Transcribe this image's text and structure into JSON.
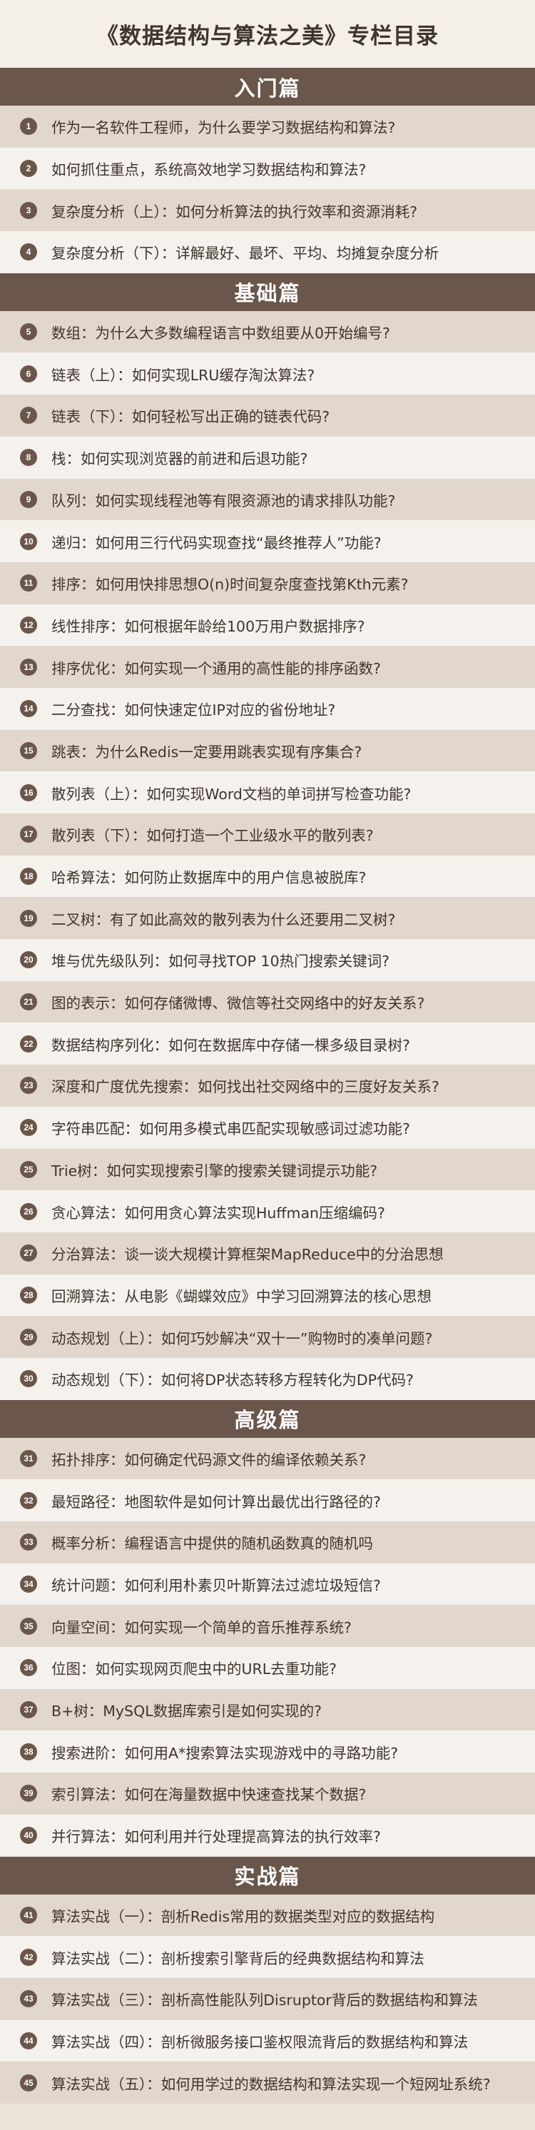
{
  "title": "《数据结构与算法之美》专栏目录",
  "sections": [
    {
      "name": "入门篇",
      "items": [
        {
          "num": "1",
          "text": "作为一名软件工程师，为什么要学习数据结构和算法?"
        },
        {
          "num": "2",
          "text": "如何抓住重点，系统高效地学习数据结构和算法?"
        },
        {
          "num": "3",
          "text": "复杂度分析（上）：如何分析算法的执行效率和资源消耗?"
        },
        {
          "num": "4",
          "text": "复杂度分析（下）：详解最好、最坏、平均、均摊复杂度分析"
        }
      ]
    },
    {
      "name": "基础篇",
      "items": [
        {
          "num": "5",
          "text": "数组：为什么大多数编程语言中数组要从0开始编号?"
        },
        {
          "num": "6",
          "text": "链表（上）：如何实现LRU缓存淘汰算法?"
        },
        {
          "num": "7",
          "text": "链表（下）：如何轻松写出正确的链表代码?"
        },
        {
          "num": "8",
          "text": "栈：如何实现浏览器的前进和后退功能?"
        },
        {
          "num": "9",
          "text": "队列：如何实现线程池等有限资源池的请求排队功能?"
        },
        {
          "num": "10",
          "text": "递归：如何用三行代码实现查找“最终推荐人”功能?"
        },
        {
          "num": "11",
          "text": "排序：如何用快排思想O(n)时间复杂度查找第Kth元素?"
        },
        {
          "num": "12",
          "text": "线性排序：如何根据年龄给100万用户数据排序?"
        },
        {
          "num": "13",
          "text": "排序优化：如何实现一个通用的高性能的排序函数?"
        },
        {
          "num": "14",
          "text": "二分查找：如何快速定位IP对应的省份地址?"
        },
        {
          "num": "15",
          "text": "跳表：为什么Redis一定要用跳表实现有序集合?"
        },
        {
          "num": "16",
          "text": "散列表（上）：如何实现Word文档的单词拼写检查功能?"
        },
        {
          "num": "17",
          "text": "散列表（下）：如何打造一个工业级水平的散列表?"
        },
        {
          "num": "18",
          "text": "哈希算法：如何防止数据库中的用户信息被脱库?"
        },
        {
          "num": "19",
          "text": "二叉树：有了如此高效的散列表为什么还要用二叉树?"
        },
        {
          "num": "20",
          "text": "堆与优先级队列：如何寻找TOP 10热门搜索关键词?"
        },
        {
          "num": "21",
          "text": "图的表示：如何存储微博、微信等社交网络中的好友关系?"
        },
        {
          "num": "22",
          "text": "数据结构序列化：如何在数据库中存储一棵多级目录树?"
        },
        {
          "num": "23",
          "text": "深度和广度优先搜索：如何找出社交网络中的三度好友关系?"
        },
        {
          "num": "24",
          "text": "字符串匹配：如何用多模式串匹配实现敏感词过滤功能?"
        },
        {
          "num": "25",
          "text": "Trie树：如何实现搜索引擎的搜索关键词提示功能?"
        },
        {
          "num": "26",
          "text": "贪心算法：如何用贪心算法实现Huffman压缩编码?"
        },
        {
          "num": "27",
          "text": "分治算法：谈一谈大规模计算框架MapReduce中的分治思想"
        },
        {
          "num": "28",
          "text": "回溯算法：从电影《蝴蝶效应》中学习回溯算法的核心思想"
        },
        {
          "num": "29",
          "text": "动态规划（上）：如何巧妙解决“双十一”购物时的凑单问题?"
        },
        {
          "num": "30",
          "text": "动态规划（下）：如何将DP状态转移方程转化为DP代码?"
        }
      ]
    },
    {
      "name": "高级篇",
      "items": [
        {
          "num": "31",
          "text": "拓扑排序：如何确定代码源文件的编译依赖关系?"
        },
        {
          "num": "32",
          "text": "最短路径：地图软件是如何计算出最优出行路径的?"
        },
        {
          "num": "33",
          "text": "概率分析：编程语言中提供的随机函数真的随机吗"
        },
        {
          "num": "34",
          "text": "统计问题：如何利用朴素贝叶斯算法过滤垃圾短信?"
        },
        {
          "num": "35",
          "text": "向量空间：如何实现一个简单的音乐推荐系统?"
        },
        {
          "num": "36",
          "text": "位图：如何实现网页爬虫中的URL去重功能?"
        },
        {
          "num": "37",
          "text": "B+树：MySQL数据库索引是如何实现的?"
        },
        {
          "num": "38",
          "text": "搜索进阶：如何用A*搜索算法实现游戏中的寻路功能?"
        },
        {
          "num": "39",
          "text": "索引算法：如何在海量数据中快速查找某个数据?"
        },
        {
          "num": "40",
          "text": "并行算法：如何利用并行处理提高算法的执行效率?"
        }
      ]
    },
    {
      "name": "实战篇",
      "items": [
        {
          "num": "41",
          "text": "算法实战（一）：剖析Redis常用的数据类型对应的数据结构"
        },
        {
          "num": "42",
          "text": "算法实战（二）：剖析搜索引擎背后的经典数据结构和算法"
        },
        {
          "num": "43",
          "text": "算法实战（三）：剖析高性能队列Disruptor背后的数据结构和算法"
        },
        {
          "num": "44",
          "text": "算法实战（四）：剖析微服务接口鉴权限流背后的数据结构和算法"
        },
        {
          "num": "45",
          "text": "算法实战（五）：如何用学过的数据结构和算法实现一个短网址系统?"
        }
      ]
    }
  ]
}
